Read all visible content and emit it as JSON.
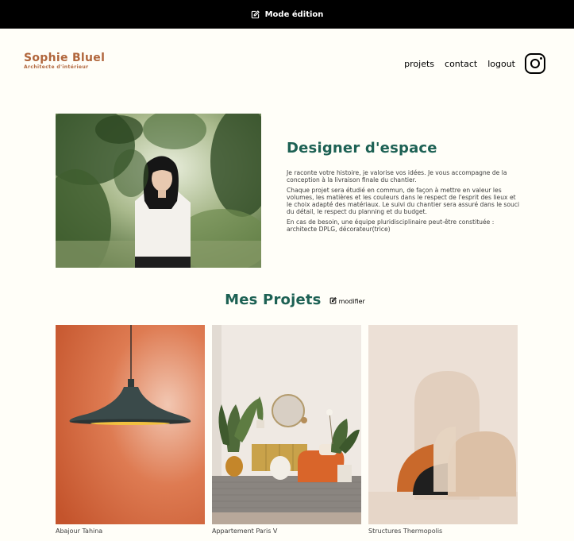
{
  "topbar": {
    "label": "Mode édition",
    "icon": "edit-icon"
  },
  "header": {
    "brand_name": "Sophie Bluel",
    "brand_subtitle": "Architecte d'intérieur",
    "nav": [
      "projets",
      "contact",
      "logout"
    ],
    "social_icon": "instagram-icon"
  },
  "intro": {
    "title": "Designer d'espace",
    "paragraphs": [
      "Je raconte votre histoire, je valorise vos idées. Je vous accompagne de la conception à la livraison finale du chantier.",
      "Chaque projet sera étudié en commun, de façon à mettre en valeur les volumes, les matières et les couleurs dans le respect de l'esprit des lieux et le choix adapté des matériaux. Le suivi du chantier sera assuré dans le souci du détail, le respect du planning et du budget.",
      "En cas de besoin, une équipe pluridisciplinaire peut-être constituée : architecte DPLG, décorateur(trice)"
    ]
  },
  "projects": {
    "title": "Mes Projets",
    "edit_label": "modifier",
    "items": [
      {
        "caption": "Abajour Tahina"
      },
      {
        "caption": "Appartement Paris V"
      },
      {
        "caption": "Structures Thermopolis"
      }
    ]
  },
  "colors": {
    "accent": "#1D6154",
    "brand": "#B1663C",
    "background": "#FFFEF8",
    "topbar": "#000000"
  }
}
